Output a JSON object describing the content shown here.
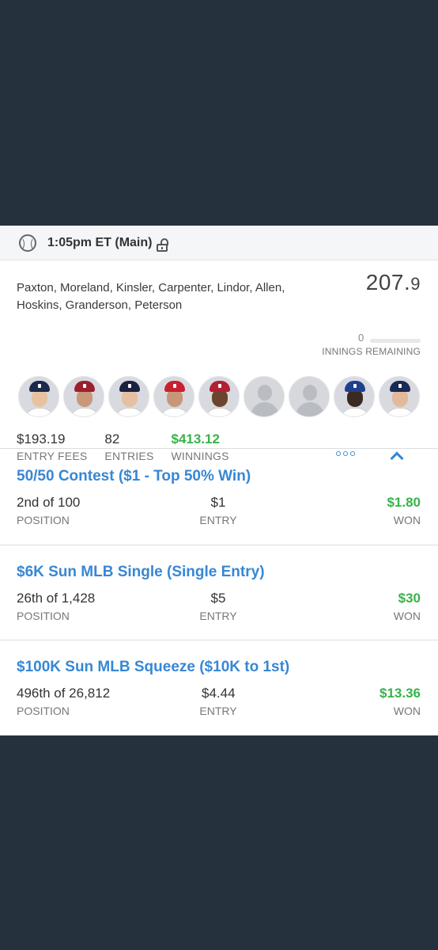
{
  "header": {
    "title": "1:05pm ET (Main)"
  },
  "summary": {
    "lineup": "Paxton, Moreland, Kinsler, Carpenter, Lindor, Allen, Hoskins, Granderson, Peterson",
    "score_whole": "207.",
    "score_decimal": "9",
    "innings_remaining": "0",
    "innings_progress": 0,
    "innings_label": "INNINGS REMAINING",
    "stats": [
      {
        "value": "$193.19",
        "label": "ENTRY FEES"
      },
      {
        "value": "82",
        "label": "ENTRIES"
      },
      {
        "value": "$413.12",
        "label": "WINNINGS"
      }
    ]
  },
  "players": [
    {
      "type": "photo",
      "cap": "#1b2a4a",
      "skin": "#e8c2a0"
    },
    {
      "type": "photo",
      "cap": "#9c1f2e",
      "skin": "#c9977a"
    },
    {
      "type": "photo",
      "cap": "#1a2240",
      "skin": "#e6c0a2"
    },
    {
      "type": "photo",
      "cap": "#c8202f",
      "skin": "#c89678"
    },
    {
      "type": "photo",
      "cap": "#b31f33",
      "skin": "#6b4430"
    },
    {
      "type": "empty"
    },
    {
      "type": "empty"
    },
    {
      "type": "photo",
      "cap": "#1f3f8f",
      "skin": "#3b2a22"
    },
    {
      "type": "photo",
      "cap": "#1a2a55",
      "skin": "#e2b99a"
    }
  ],
  "contests": [
    {
      "title": "50/50 Contest ($1 - Top 50% Win)",
      "position": "2nd of 100",
      "position_label": "POSITION",
      "entry": "$1",
      "entry_label": "ENTRY",
      "won": "$1.80",
      "won_label": "WON"
    },
    {
      "title": "$6K Sun MLB Single (Single Entry)",
      "position": "26th of 1,428",
      "position_label": "POSITION",
      "entry": "$5",
      "entry_label": "ENTRY",
      "won": "$30",
      "won_label": "WON"
    },
    {
      "title": "$100K Sun MLB Squeeze ($10K to 1st)",
      "position": "496th of 26,812",
      "position_label": "POSITION",
      "entry": "$4.44",
      "entry_label": "ENTRY",
      "won": "$13.36",
      "won_label": "WON"
    }
  ],
  "colors": {
    "accent": "#3787d4",
    "win": "#38b24a",
    "background": "#26313e"
  }
}
